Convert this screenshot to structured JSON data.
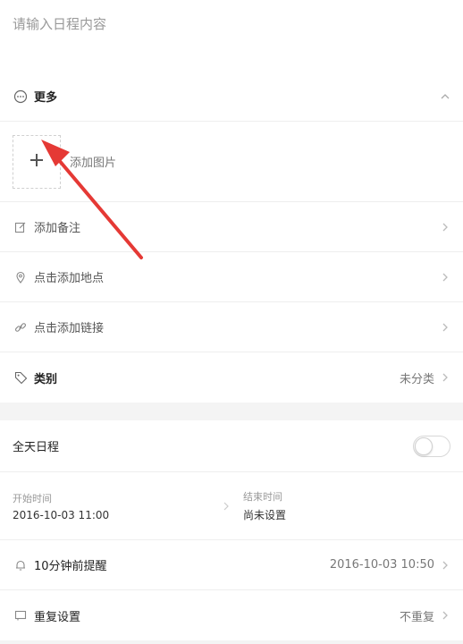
{
  "title_input": {
    "placeholder": "请输入日程内容"
  },
  "more": {
    "label": "更多"
  },
  "add_image": {
    "label": "添加图片"
  },
  "rows": {
    "note": "添加备注",
    "location": "点击添加地点",
    "link": "点击添加链接",
    "category": {
      "label": "类别",
      "value": "未分类"
    }
  },
  "all_day": {
    "label": "全天日程",
    "enabled": false
  },
  "time": {
    "start_label": "开始时间",
    "start_value": "2016-10-03 11:00",
    "end_label": "结束时间",
    "end_value": "尚未设置"
  },
  "reminder": {
    "label": "10分钟前提醒",
    "value": "2016-10-03 10:50"
  },
  "repeat": {
    "label": "重复设置",
    "value": "不重复"
  },
  "colors": {
    "arrow": "#e53935",
    "divider": "#eeeeee",
    "background": "#f4f4f4"
  },
  "icons": [
    "more-icon",
    "chevron-up-icon",
    "plus-icon",
    "edit-icon",
    "location-pin-icon",
    "link-icon",
    "tag-icon",
    "bell-icon",
    "repeat-icon",
    "chevron-right-icon"
  ]
}
